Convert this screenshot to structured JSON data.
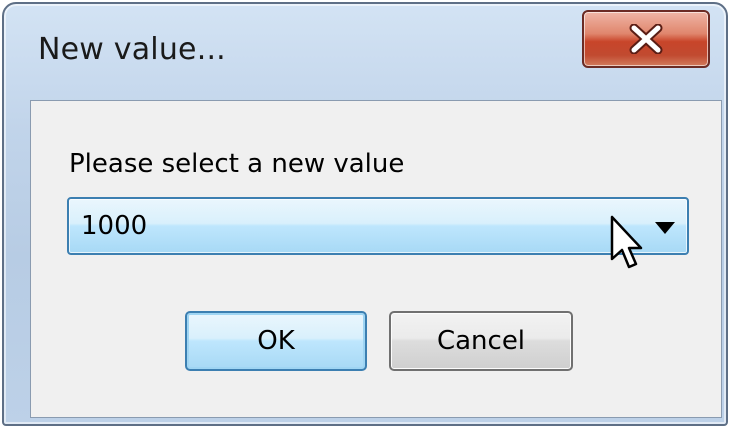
{
  "dialog": {
    "title": "New value...",
    "close_icon": "close-x-icon",
    "prompt": "Please select a new value",
    "select": {
      "value": "1000",
      "arrow_icon": "dropdown-arrow-icon"
    },
    "buttons": {
      "ok": "OK",
      "cancel": "Cancel"
    }
  },
  "colors": {
    "titlebar": "#c1d4ea",
    "close_button": "#c8452a",
    "focus_border": "#3c7fb1",
    "client_bg": "#f0f0f0"
  }
}
